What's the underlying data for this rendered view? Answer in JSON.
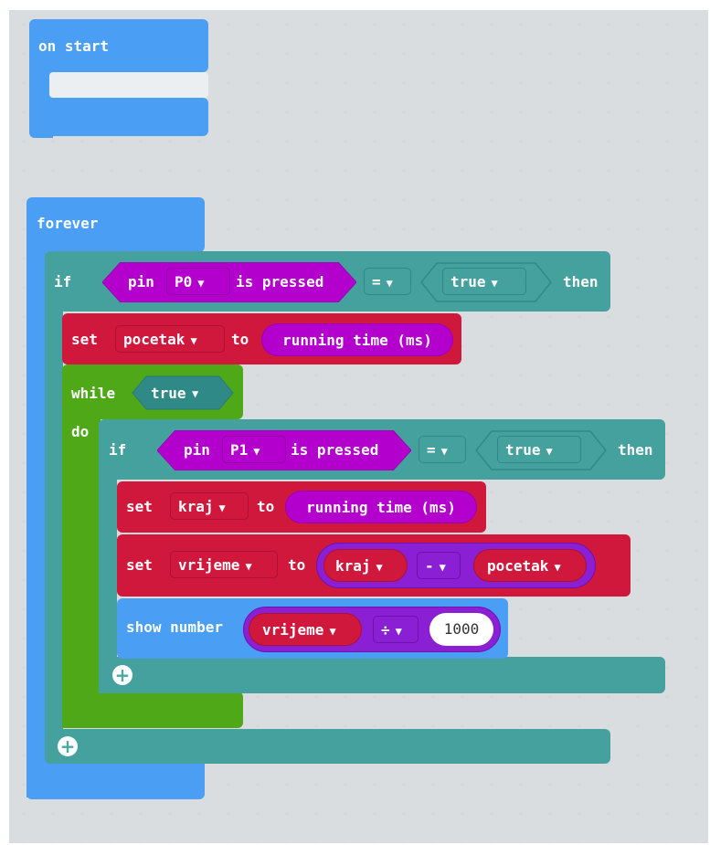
{
  "workspace": {
    "on_start": {
      "label": "on start"
    },
    "forever": {
      "label": "forever",
      "if_outer": {
        "if_label": "if",
        "condition": {
          "pin_label": "pin",
          "pin_value": "P0",
          "is_pressed": "is pressed",
          "op": "=",
          "bool": "true"
        },
        "then_label": "then"
      },
      "set_pocetak": {
        "set_label": "set",
        "var": "pocetak",
        "to_label": "to",
        "value": "running time (ms)"
      },
      "while": {
        "while_label": "while",
        "cond": "true",
        "do_label": "do"
      },
      "if_inner": {
        "if_label": "if",
        "condition": {
          "pin_label": "pin",
          "pin_value": "P1",
          "is_pressed": "is pressed",
          "op": "=",
          "bool": "true"
        },
        "then_label": "then"
      },
      "set_kraj": {
        "set_label": "set",
        "var": "kraj",
        "to_label": "to",
        "value": "running time (ms)"
      },
      "set_vrijeme": {
        "set_label": "set",
        "var": "vrijeme",
        "to_label": "to",
        "left": "kraj",
        "op": "-",
        "right": "pocetak"
      },
      "show_number": {
        "label": "show number",
        "var": "vrijeme",
        "op": "÷",
        "value": "1000"
      }
    }
  },
  "colors": {
    "basic_blue": "#4a9ef4",
    "logic_teal": "#45a19e",
    "variable_red": "#d0183d",
    "pin_magenta": "#b300cc",
    "loop_green": "#4fa818",
    "math_purple": "#8a1fd4"
  }
}
